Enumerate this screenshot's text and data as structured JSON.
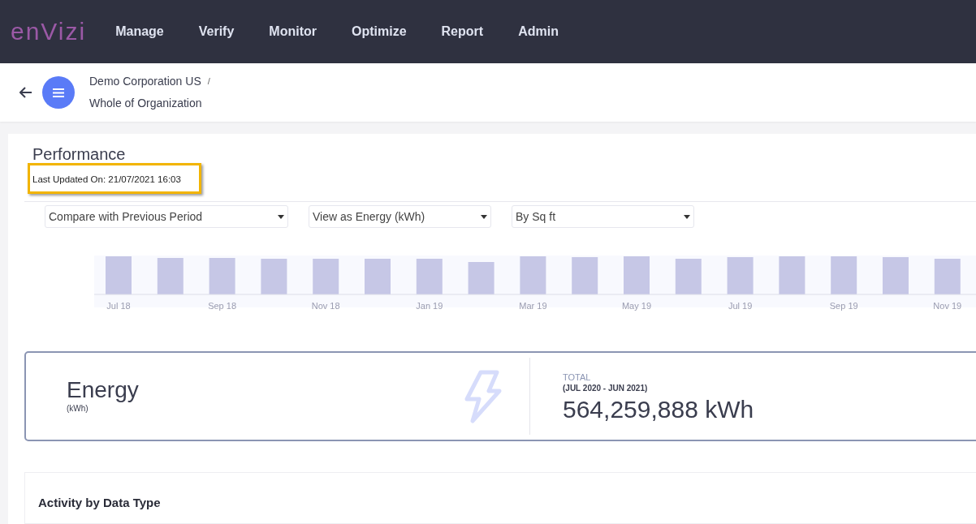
{
  "nav": {
    "logo": "enVizi",
    "items": [
      {
        "label": "Manage"
      },
      {
        "label": "Verify"
      },
      {
        "label": "Monitor"
      },
      {
        "label": "Optimize"
      },
      {
        "label": "Report"
      },
      {
        "label": "Admin"
      }
    ]
  },
  "breadcrumb": {
    "parent": "Demo Corporation US",
    "separator": "/",
    "current": "Whole of Organization"
  },
  "performance": {
    "title": "Performance",
    "last_updated": "Last Updated On: 21/07/2021 16:03",
    "dropdowns": [
      {
        "value": "Compare with Previous Period"
      },
      {
        "value": "View as Energy (kWh)"
      },
      {
        "value": "By Sq ft"
      }
    ],
    "chart_axis_labels": [
      "Jul 18",
      "Sep 18",
      "Nov 18",
      "Jan 19",
      "Mar 19",
      "May 19",
      "Jul 19",
      "Sep 19",
      "Nov 19"
    ]
  },
  "energy_card": {
    "title": "Energy",
    "unit": "(kWh)",
    "total_label": "TOTAL",
    "period": "(JUL 2020 - JUN 2021)",
    "total": "564,259,888 kWh"
  },
  "activity": {
    "title": "Activity by Data Type"
  }
}
